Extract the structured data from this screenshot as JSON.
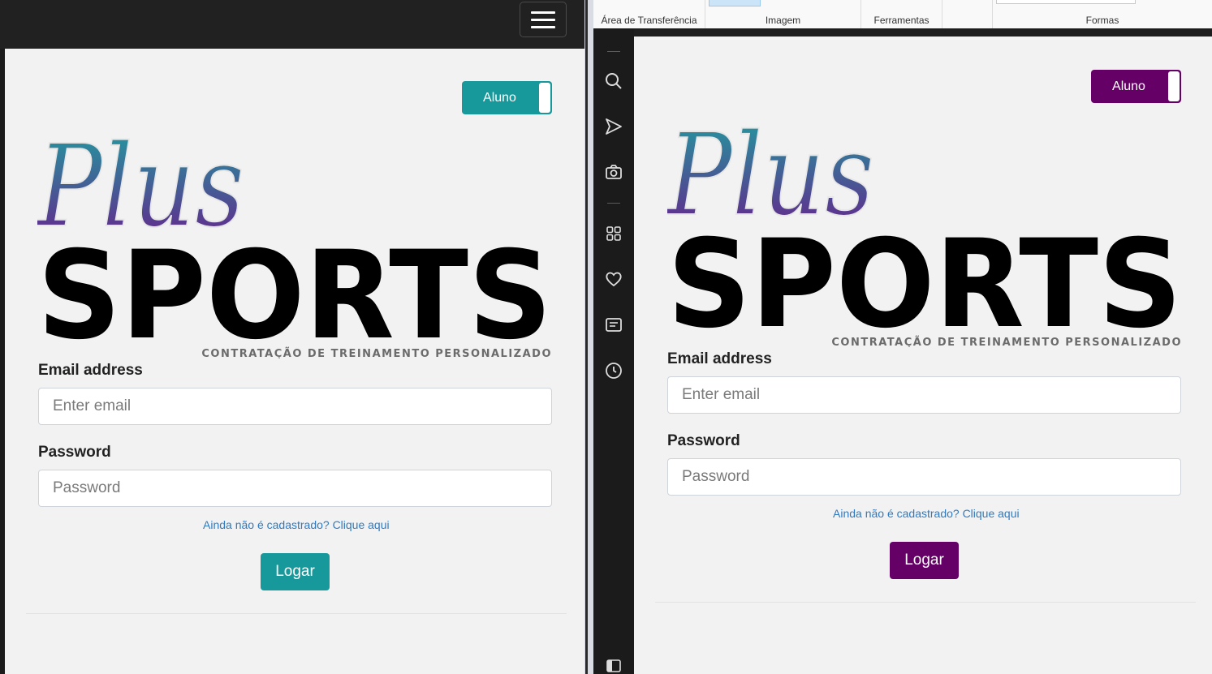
{
  "colors": {
    "left_accent": "#17999b",
    "right_accent": "#650066",
    "logo_gradient_top": "#1fa0a0",
    "logo_gradient_bottom": "#6a1b8a"
  },
  "left_app": {
    "menu_icon": "hamburger-icon",
    "toggle_label": "Aluno",
    "logo_plus": "Plus",
    "logo_sports": "SPORTS",
    "logo_tagline": "CONTRATAÇÃO DE TREINAMENTO PERSONALIZADO",
    "email_label": "Email address",
    "email_placeholder": "Enter email",
    "password_label": "Password",
    "password_placeholder": "Password",
    "signup_link": "Ainda não é cadastrado? Clique aqui",
    "login_button": "Logar"
  },
  "ribbon": {
    "groups": [
      "Área de Transferência",
      "Imagem",
      "Ferramentas",
      "Formas"
    ]
  },
  "sidebar": {
    "icons": [
      "search-icon",
      "send-icon",
      "camera-icon",
      "apps-icon",
      "heart-icon",
      "news-icon",
      "history-icon",
      "panel-icon"
    ]
  },
  "right_app": {
    "toggle_label": "Aluno",
    "logo_plus": "Plus",
    "logo_sports": "SPORTS",
    "logo_tagline": "CONTRATAÇÃO DE TREINAMENTO PERSONALIZADO",
    "email_label": "Email address",
    "email_placeholder": "Enter email",
    "password_label": "Password",
    "password_placeholder": "Password",
    "signup_link": "Ainda não é cadastrado? Clique aqui",
    "login_button": "Logar"
  }
}
